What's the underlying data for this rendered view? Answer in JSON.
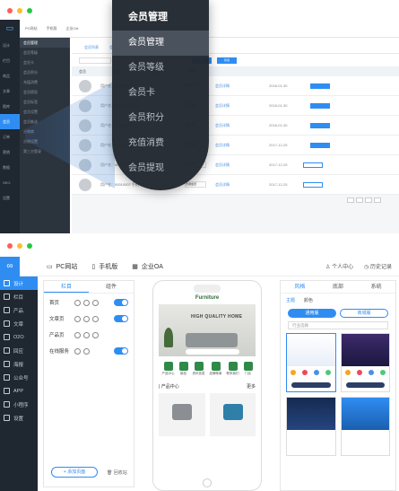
{
  "theme": {
    "accent": "#2f8df2",
    "dark": "#1f2730",
    "mac_red": "#ff5f57",
    "mac_yellow": "#febc2e",
    "mac_green": "#28c840"
  },
  "window1": {
    "sidebar": [
      "设计",
      "栏目",
      "商品",
      "文章",
      "图库",
      "会员",
      "订单",
      "营销",
      "数据",
      "SEO",
      "设置"
    ],
    "subnav": [
      "会员管理",
      "会员等级",
      "会员卡",
      "会员积分",
      "充值消费",
      "会员提现",
      "会员标签",
      "会员设置",
      "会员推送",
      "分销商",
      "分销设置",
      "第三方登录"
    ],
    "tabs": [
      "会员列表",
      "会员审核",
      "会员统计",
      "会员导出"
    ],
    "filter_button": "搜索",
    "filter_button2": "筛选",
    "table_headers": [
      "会员",
      "等级",
      "注册时间",
      "操作"
    ],
    "rows": [
      {
        "info": "用户名：18803 手机号：",
        "level": "普通会员",
        "link": "会员详情",
        "date": "2018-01-30"
      },
      {
        "info": "用户名：10027 手机号：",
        "level": "普通会员",
        "link": "会员详情",
        "date": "2018-01-30"
      },
      {
        "info": "用户名：10003 手机号：",
        "level": "普通会员",
        "link": "会员详情",
        "date": "2018-01-30"
      },
      {
        "info": "用户名：10001 手机号：",
        "level": "普通会员",
        "link": "会员详情",
        "date": "2017-12-25"
      },
      {
        "info": "用户名：00010005 手机号：",
        "level": "普通会员",
        "link": "会员详情",
        "date": "2017-12-25"
      },
      {
        "info": "用户名：00010007 手机号：",
        "level": "普通会员",
        "link": "会员详情",
        "date": "2017-12-25"
      }
    ],
    "popup": {
      "title": "会员管理",
      "items": [
        "会员管理",
        "会员等级",
        "会员卡",
        "会员积分",
        "充值消费",
        "会员提现"
      ]
    }
  },
  "window2": {
    "top_nav": [
      {
        "icon": "monitor-icon",
        "label": "PC网站"
      },
      {
        "icon": "phone-icon",
        "label": "手机版"
      },
      {
        "icon": "building-icon",
        "label": "企业OA"
      }
    ],
    "top_right": [
      "个人中心",
      "历史记录"
    ],
    "sidebar": [
      {
        "icon": "design-icon",
        "label": "设计"
      },
      {
        "icon": "column-icon",
        "label": "栏目"
      },
      {
        "icon": "product-icon",
        "label": "产品"
      },
      {
        "icon": "article-icon",
        "label": "文章"
      },
      {
        "icon": "o2o-icon",
        "label": "O2O"
      },
      {
        "icon": "group-buy-icon",
        "label": "回应"
      },
      {
        "icon": "poster-icon",
        "label": "海报"
      },
      {
        "icon": "wechat-icon",
        "label": "公众号"
      },
      {
        "icon": "app-icon",
        "label": "APP"
      },
      {
        "icon": "mini-program-icon",
        "label": "小程序"
      },
      {
        "icon": "settings-icon",
        "label": "设置"
      }
    ],
    "left_panel": {
      "tabs": [
        "栏目",
        "组件"
      ],
      "rows": [
        "首页",
        "文章页",
        "产品页",
        "在线服务"
      ],
      "add_button": "+ 添加页面",
      "recycle": "回收站"
    },
    "phone": {
      "brand": "Furniture",
      "hero_title": "HIGH QUALITY HOME",
      "search_placeholder": "请输入搜索内容",
      "icons": [
        "产品中心",
        "新品",
        "资讯信息",
        "品牌故事",
        "联系我们",
        "门店"
      ],
      "section_title": "| 产品中心",
      "section_more": "更多"
    },
    "right_panel": {
      "tabs": [
        "风格",
        "底部",
        "系统"
      ],
      "subtabs": [
        "主题",
        "颜色"
      ],
      "segments": [
        "通用版",
        "商城版"
      ],
      "select": "行业选择"
    }
  }
}
